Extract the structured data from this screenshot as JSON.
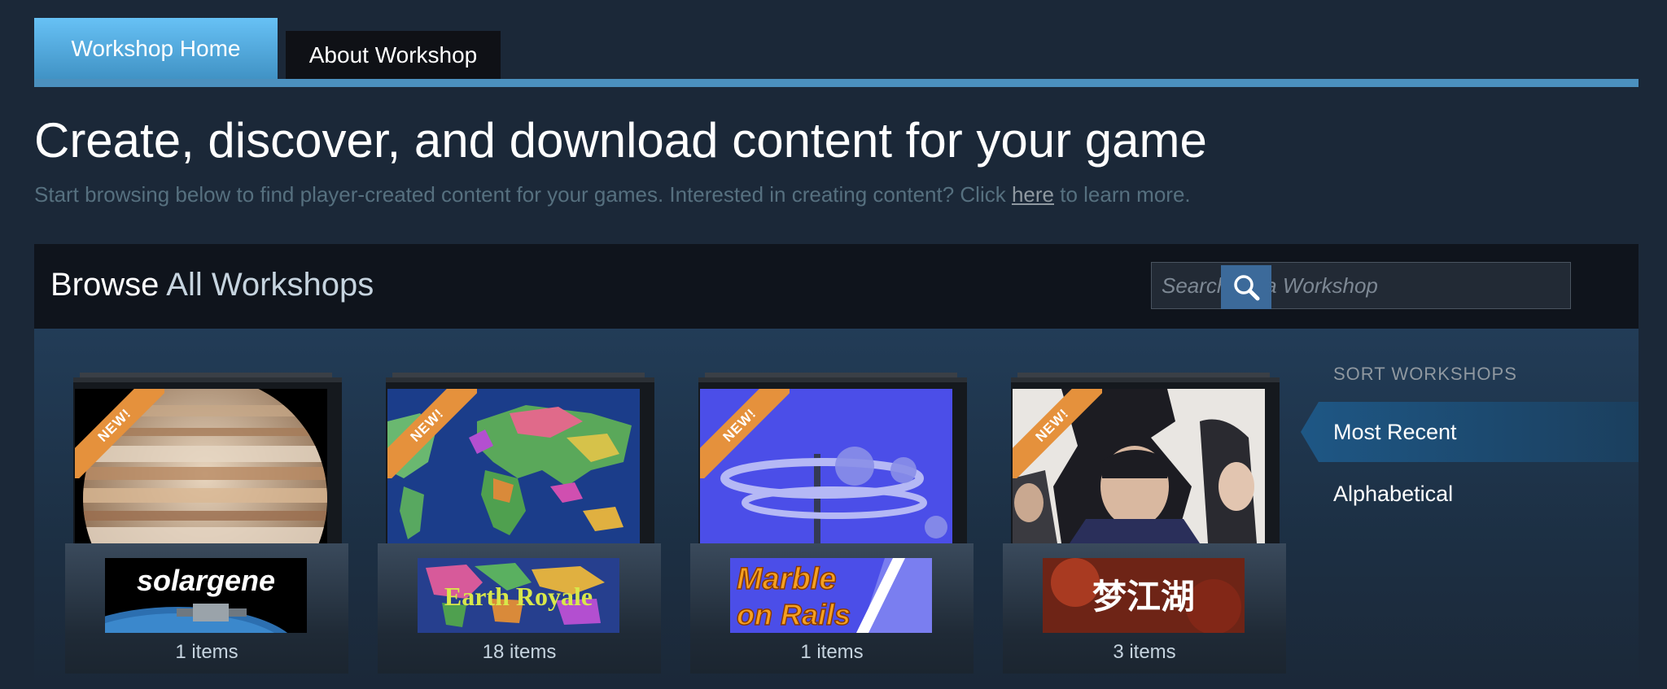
{
  "tabs": [
    {
      "label": "Workshop Home",
      "active": true
    },
    {
      "label": "About Workshop",
      "active": false
    }
  ],
  "hero": {
    "title": "Create, discover, and download content for your game",
    "subtitle_before": "Start browsing below to find player-created content for your games. Interested in creating content? Click ",
    "subtitle_link": "here",
    "subtitle_after": " to learn more."
  },
  "browse": {
    "title_strong": "Browse",
    "title_rest": " All Workshops",
    "search_placeholder": "Search for a Workshop",
    "search_icon": "search-icon"
  },
  "workshops": [
    {
      "badge": "NEW!",
      "logo_text": "solargene",
      "count": "1 items"
    },
    {
      "badge": "NEW!",
      "logo_text": "Earth Royale",
      "count": "18 items"
    },
    {
      "badge": "NEW!",
      "logo_text_1": "Marble",
      "logo_text_2": "on Rails",
      "count": "1 items"
    },
    {
      "badge": "NEW!",
      "logo_text": "梦江湖",
      "count": "3 items"
    }
  ],
  "sort": {
    "title": "SORT WORKSHOPS",
    "items": [
      {
        "label": "Most Recent",
        "active": true
      },
      {
        "label": "Alphabetical",
        "active": false
      }
    ]
  },
  "colors": {
    "background": "#1b2838",
    "tab_active": "#67c1f5",
    "badge": "#e5913c",
    "accent": "#4b90be"
  }
}
